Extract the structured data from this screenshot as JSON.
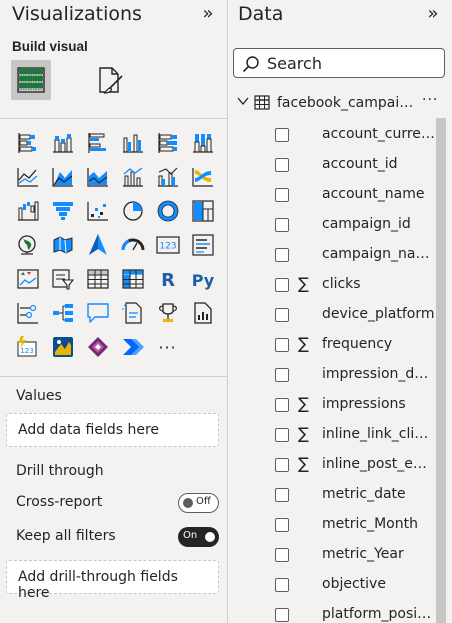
{
  "visualizations": {
    "title": "Visualizations",
    "build_visual": "Build visual",
    "more_visuals": "···",
    "values_label": "Values",
    "values_placeholder": "Add data fields here",
    "drill_through_label": "Drill through",
    "cross_report_label": "Cross-report",
    "cross_report_toggle": "Off",
    "keep_filters_label": "Keep all filters",
    "keep_filters_toggle": "On",
    "drill_placeholder": "Add drill-through fields here"
  },
  "data": {
    "title": "Data",
    "search_placeholder": "Search",
    "table_name": "facebook_campaign_metrics",
    "table_more": "···",
    "fields": [
      {
        "name": "account_currency",
        "sigma": ""
      },
      {
        "name": "account_id",
        "sigma": ""
      },
      {
        "name": "account_name",
        "sigma": ""
      },
      {
        "name": "campaign_id",
        "sigma": ""
      },
      {
        "name": "campaign_name",
        "sigma": ""
      },
      {
        "name": "clicks",
        "sigma": "∑"
      },
      {
        "name": "device_platform",
        "sigma": ""
      },
      {
        "name": "frequency",
        "sigma": "∑"
      },
      {
        "name": "impression_device",
        "sigma": ""
      },
      {
        "name": "impressions",
        "sigma": "∑"
      },
      {
        "name": "inline_link_clicks",
        "sigma": "∑"
      },
      {
        "name": "inline_post_engagement",
        "sigma": "∑"
      },
      {
        "name": "metric_date",
        "sigma": ""
      },
      {
        "name": "metric_Month",
        "sigma": ""
      },
      {
        "name": "metric_Year",
        "sigma": ""
      },
      {
        "name": "objective",
        "sigma": ""
      },
      {
        "name": "platform_position",
        "sigma": ""
      }
    ]
  },
  "colors": {
    "pane_bg": "#f3f2f1",
    "accent_yellow": "#e8b600",
    "accent_blue": "#118dff",
    "icon_dark": "#252423"
  }
}
